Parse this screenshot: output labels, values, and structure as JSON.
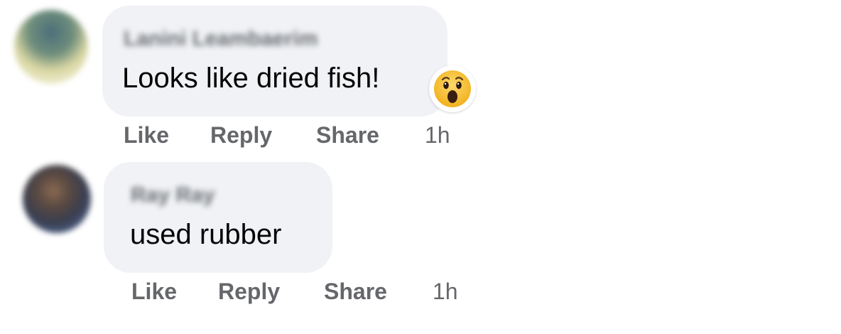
{
  "comments": [
    {
      "author": "Lanini Leambaerim",
      "text": "Looks like dried fish!",
      "reaction": "wow-emoji",
      "actions": {
        "like": "Like",
        "reply": "Reply",
        "share": "Share"
      },
      "time": "1h"
    },
    {
      "author": "Ray Ray",
      "text": "used rubber",
      "actions": {
        "like": "Like",
        "reply": "Reply",
        "share": "Share"
      },
      "time": "1h"
    }
  ],
  "colors": {
    "bubble_bg": "#f0f2f5",
    "text": "#050505",
    "secondary_text": "#65676b",
    "reaction_yellow": "#f7b125"
  }
}
